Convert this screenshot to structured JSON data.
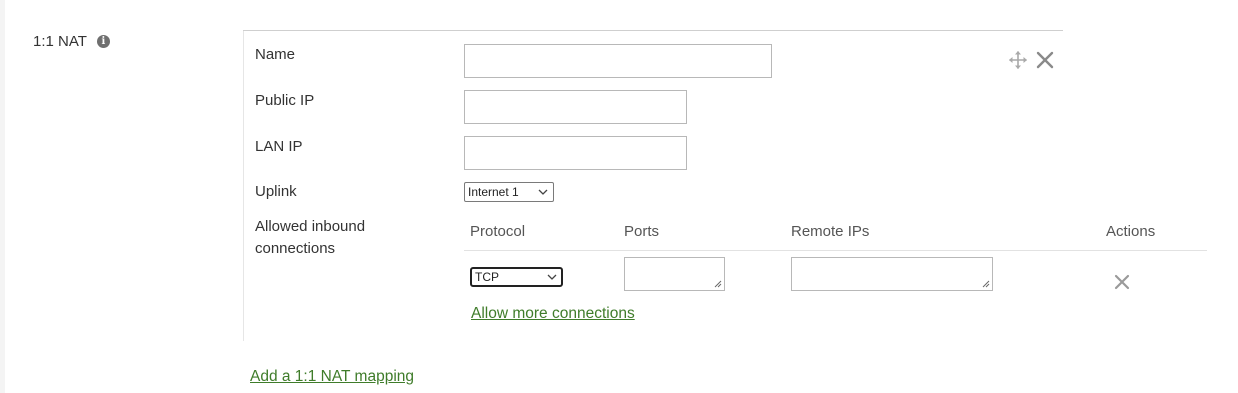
{
  "section": {
    "label": "1:1 NAT",
    "info_icon": "info-icon"
  },
  "mapping": {
    "name_label": "Name",
    "name_value": "",
    "public_ip_label": "Public IP",
    "public_ip_value": "",
    "lan_ip_label": "LAN IP",
    "lan_ip_value": "",
    "uplink_label": "Uplink",
    "uplink_value": "Internet 1",
    "allowed_label_line1": "Allowed inbound",
    "allowed_label_line2": "connections",
    "icons": {
      "move": "move-icon",
      "remove": "close-icon"
    }
  },
  "connections": {
    "headers": {
      "protocol": "Protocol",
      "ports": "Ports",
      "remote_ips": "Remote IPs",
      "actions": "Actions"
    },
    "rows": [
      {
        "protocol": "TCP",
        "ports": "",
        "remote_ips": ""
      }
    ],
    "allow_more_link": "Allow more connections"
  },
  "add_mapping_link": "Add a 1:1 NAT mapping",
  "colors": {
    "link": "#3f7c2a",
    "border": "#b8b8b8",
    "icon": "#8a8a8a"
  }
}
